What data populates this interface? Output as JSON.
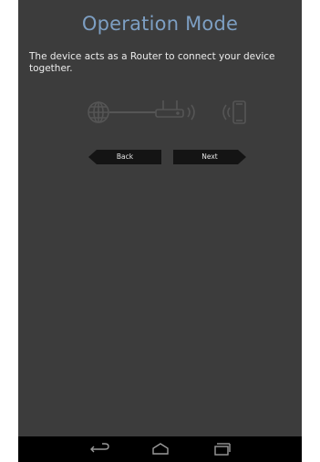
{
  "header": {
    "title": "Operation Mode"
  },
  "content": {
    "description": "The device acts as a Router to connect your device together."
  },
  "diagram": {
    "icons": [
      "globe-icon",
      "router-icon",
      "wifi-signal-icon",
      "mobile-device-icon"
    ]
  },
  "buttons": {
    "back_label": "Back",
    "next_label": "Next"
  },
  "system_nav": {
    "icons": [
      "back-nav-icon",
      "home-nav-icon",
      "recent-apps-icon"
    ]
  },
  "colors": {
    "background": "#3c3c3c",
    "title": "#7d9fc3",
    "button": "#141414",
    "navbar": "#000000"
  }
}
